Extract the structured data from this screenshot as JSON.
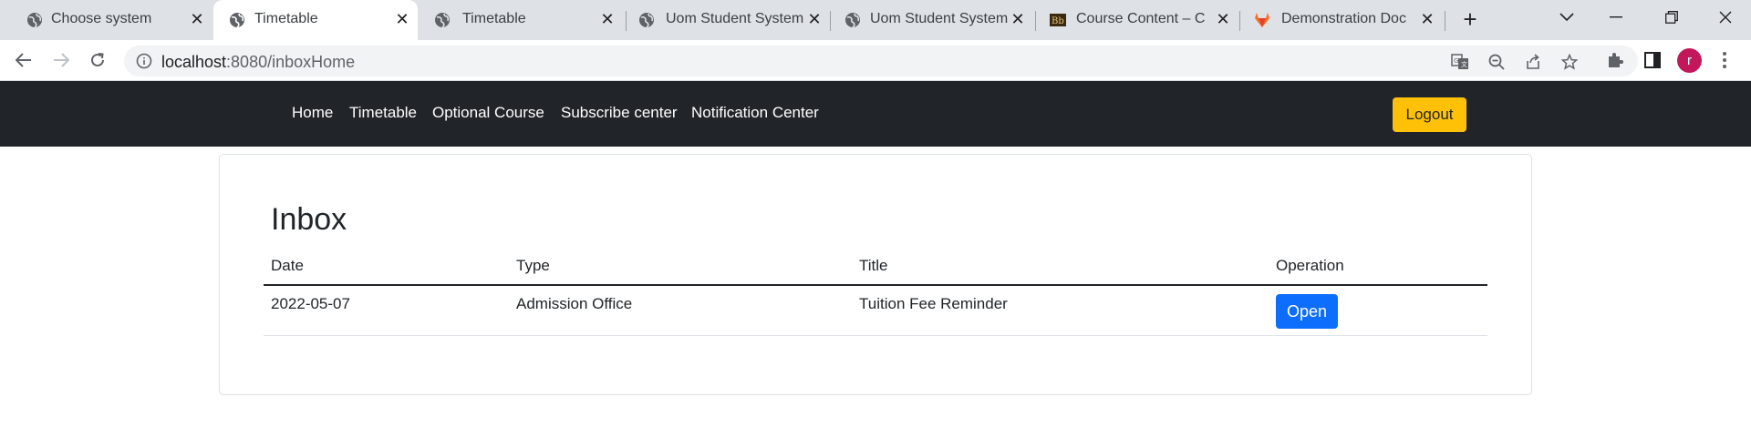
{
  "browser": {
    "tabs": [
      {
        "title": "Choose system",
        "icon": "globe-icon",
        "active": false
      },
      {
        "title": "Timetable",
        "icon": "globe-icon",
        "active": true
      },
      {
        "title": "Timetable",
        "icon": "globe-icon",
        "active": false
      },
      {
        "title": "Uom Student System",
        "icon": "globe-icon",
        "active": false
      },
      {
        "title": "Uom Student System",
        "icon": "globe-icon",
        "active": false
      },
      {
        "title": "Course Content – C",
        "icon": "blackboard-icon",
        "active": false
      },
      {
        "title": "Demonstration Doc",
        "icon": "gitlab-icon",
        "active": false
      }
    ],
    "address": {
      "host": "localhost",
      "rest": ":8080/inboxHome"
    },
    "profile_initial": "r",
    "colors": {
      "tabstrip": "#dee1e6",
      "avatar": "#c2185b"
    }
  },
  "navbar": {
    "links": [
      "Home",
      "Timetable",
      "Optional Course",
      "Subscribe center",
      "Notification Center"
    ],
    "logout_label": "Logout",
    "colors": {
      "background": "#212529",
      "logout": "#ffc107"
    }
  },
  "inbox": {
    "title": "Inbox",
    "columns": [
      "Date",
      "Type",
      "Title",
      "Operation"
    ],
    "rows": [
      {
        "date": "2022-05-07",
        "type": "Admission Office",
        "title": "Tuition Fee Reminder",
        "action_label": "Open"
      }
    ],
    "colors": {
      "open_button": "#0d6efd"
    }
  }
}
